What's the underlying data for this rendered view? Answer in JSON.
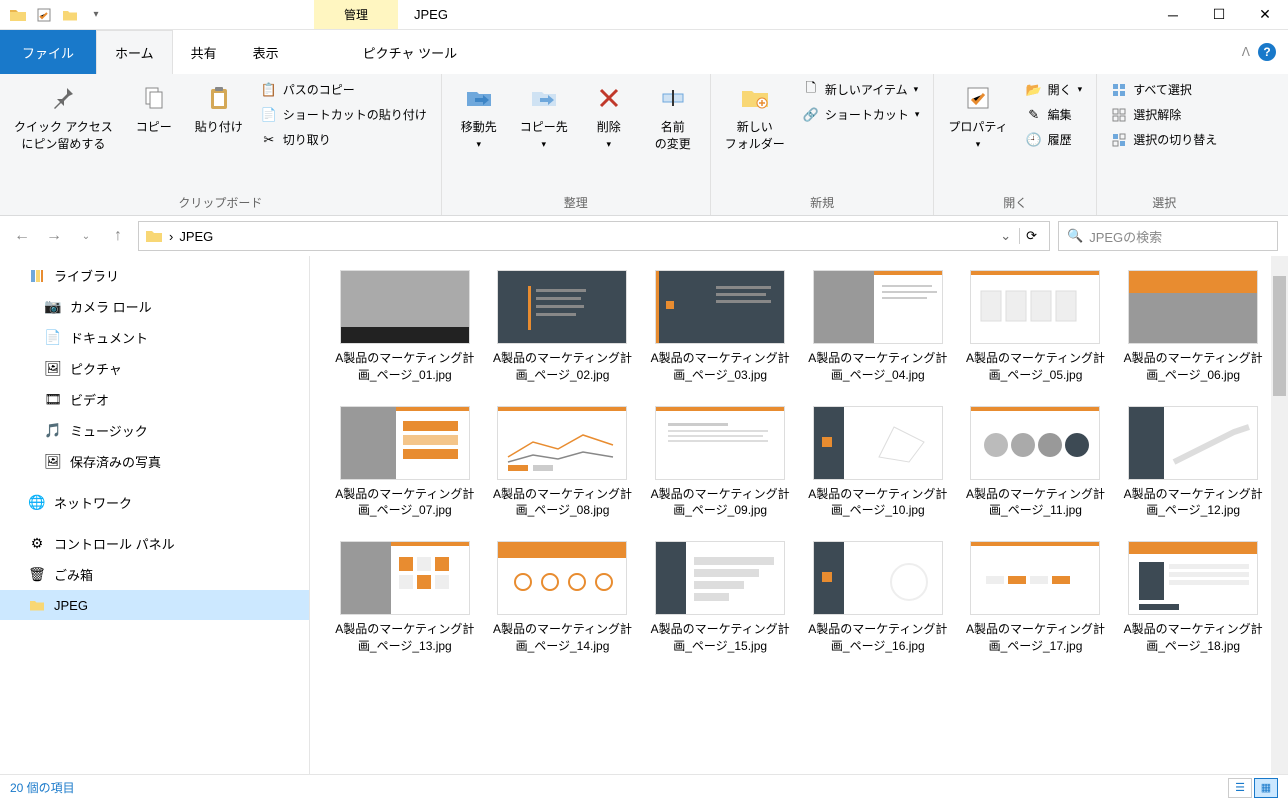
{
  "titlebar": {
    "contextual_tab": "管理",
    "window_title": "JPEG"
  },
  "tabs": {
    "file": "ファイル",
    "home": "ホーム",
    "share": "共有",
    "view": "表示",
    "picture_tools": "ピクチャ ツール"
  },
  "ribbon": {
    "clipboard": {
      "pin_quick_access": "クイック アクセス\nにピン留めする",
      "copy": "コピー",
      "paste": "貼り付け",
      "copy_path": "パスのコピー",
      "paste_shortcut": "ショートカットの貼り付け",
      "cut": "切り取り",
      "group": "クリップボード"
    },
    "organize": {
      "move_to": "移動先",
      "copy_to": "コピー先",
      "delete": "削除",
      "rename": "名前\nの変更",
      "group": "整理"
    },
    "new": {
      "new_folder": "新しい\nフォルダー",
      "new_item": "新しいアイテム",
      "shortcut": "ショートカット",
      "group": "新規"
    },
    "open": {
      "properties": "プロパティ",
      "open": "開く",
      "edit": "編集",
      "history": "履歴",
      "group": "開く"
    },
    "select": {
      "select_all": "すべて選択",
      "select_none": "選択解除",
      "invert": "選択の切り替え",
      "group": "選択"
    }
  },
  "address": {
    "path": "JPEG",
    "separator": "›"
  },
  "search": {
    "placeholder": "JPEGの検索"
  },
  "sidebar": {
    "library": "ライブラリ",
    "camera_roll": "カメラ ロール",
    "documents": "ドキュメント",
    "pictures": "ピクチャ",
    "videos": "ビデオ",
    "music": "ミュージック",
    "saved_pictures": "保存済みの写真",
    "network": "ネットワーク",
    "control_panel": "コントロール パネル",
    "recycle_bin": "ごみ箱",
    "jpeg": "JPEG"
  },
  "files": [
    {
      "name": "A製品のマーケティング計画_ページ_01.jpg",
      "thumb": "photo-dark"
    },
    {
      "name": "A製品のマーケティング計画_ページ_02.jpg",
      "thumb": "dark"
    },
    {
      "name": "A製品のマーケティング計画_ページ_03.jpg",
      "thumb": "dark-split"
    },
    {
      "name": "A製品のマーケティング計画_ページ_04.jpg",
      "thumb": "photo-split"
    },
    {
      "name": "A製品のマーケティング計画_ページ_05.jpg",
      "thumb": "white-boxes"
    },
    {
      "name": "A製品のマーケティング計画_ページ_06.jpg",
      "thumb": "orange-photo"
    },
    {
      "name": "A製品のマーケティング計画_ページ_07.jpg",
      "thumb": "photo-list"
    },
    {
      "name": "A製品のマーケティング計画_ページ_08.jpg",
      "thumb": "white-chart"
    },
    {
      "name": "A製品のマーケティング計画_ページ_09.jpg",
      "thumb": "white-text"
    },
    {
      "name": "A製品のマーケティング計画_ページ_10.jpg",
      "thumb": "dark-split2"
    },
    {
      "name": "A製品のマーケティング計画_ページ_11.jpg",
      "thumb": "white-circles"
    },
    {
      "name": "A製品のマーケティング計画_ページ_12.jpg",
      "thumb": "dark-chart"
    },
    {
      "name": "A製品のマーケティング計画_ページ_13.jpg",
      "thumb": "photo-grid"
    },
    {
      "name": "A製品のマーケティング計画_ページ_14.jpg",
      "thumb": "orange-icons"
    },
    {
      "name": "A製品のマーケティング計画_ページ_15.jpg",
      "thumb": "dark-bars"
    },
    {
      "name": "A製品のマーケティング計画_ページ_16.jpg",
      "thumb": "dark-plain"
    },
    {
      "name": "A製品のマーケティング計画_ページ_17.jpg",
      "thumb": "white-table"
    },
    {
      "name": "A製品のマーケティング計画_ページ_18.jpg",
      "thumb": "orange-table"
    }
  ],
  "status": {
    "item_count": "20 個の項目"
  },
  "colors": {
    "accent": "#1979ca",
    "ribbon_bg": "#f5f6f7",
    "contextual": "#fff6c1",
    "selection": "#cce8ff",
    "orange": "#e88c30"
  }
}
